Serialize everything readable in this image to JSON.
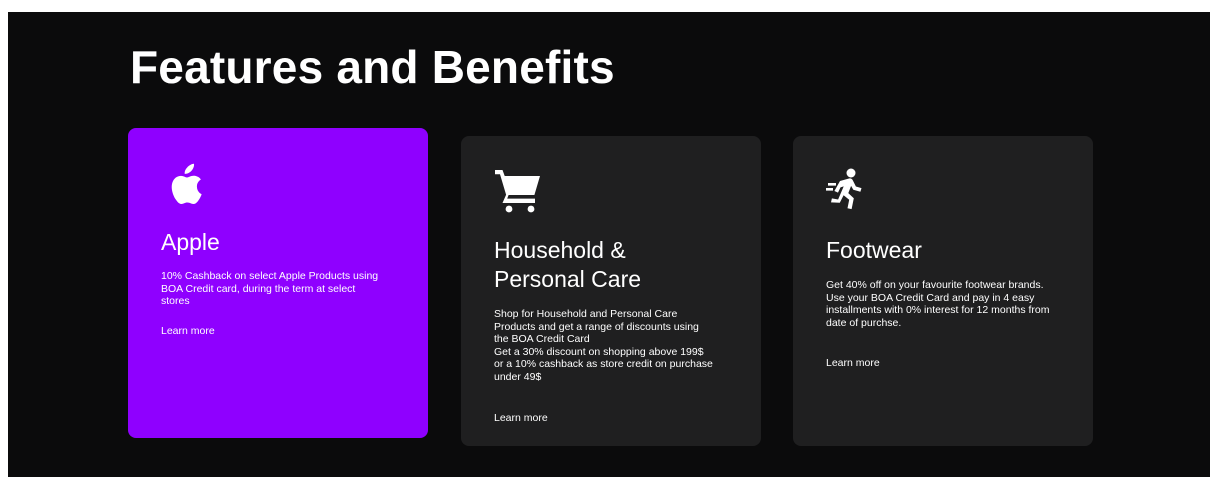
{
  "section": {
    "title": "Features and Benefits"
  },
  "cards": [
    {
      "icon": "apple-logo-icon",
      "title": "Apple",
      "description": "10% Cashback on select Apple Products using\nBOA Credit card, during the term at select\nstores",
      "link_label": "Learn more",
      "background": "#8f00ff"
    },
    {
      "icon": "shopping-cart-icon",
      "title": "Household &\nPersonal Care",
      "description": "Shop for Household and Personal Care\nProducts and get a range of discounts using\nthe BOA Credit Card\nGet a 30% discount on shopping above 199$\nor a 10% cashback as store credit on purchase\nunder 49$",
      "link_label": "Learn more",
      "background": "#1f1f20"
    },
    {
      "icon": "running-person-icon",
      "title": "Footwear",
      "description": "Get 40% off on your favourite footwear brands.\nUse your BOA Credit Card and pay in 4 easy\ninstallments with 0% interest for 12 months from\ndate of purchse.",
      "link_label": "Learn more",
      "background": "#1f1f20"
    }
  ],
  "colors": {
    "page_background": "#0b0b0c",
    "accent": "#8f00ff",
    "card_background": "#1f1f20",
    "text": "#ffffff"
  }
}
